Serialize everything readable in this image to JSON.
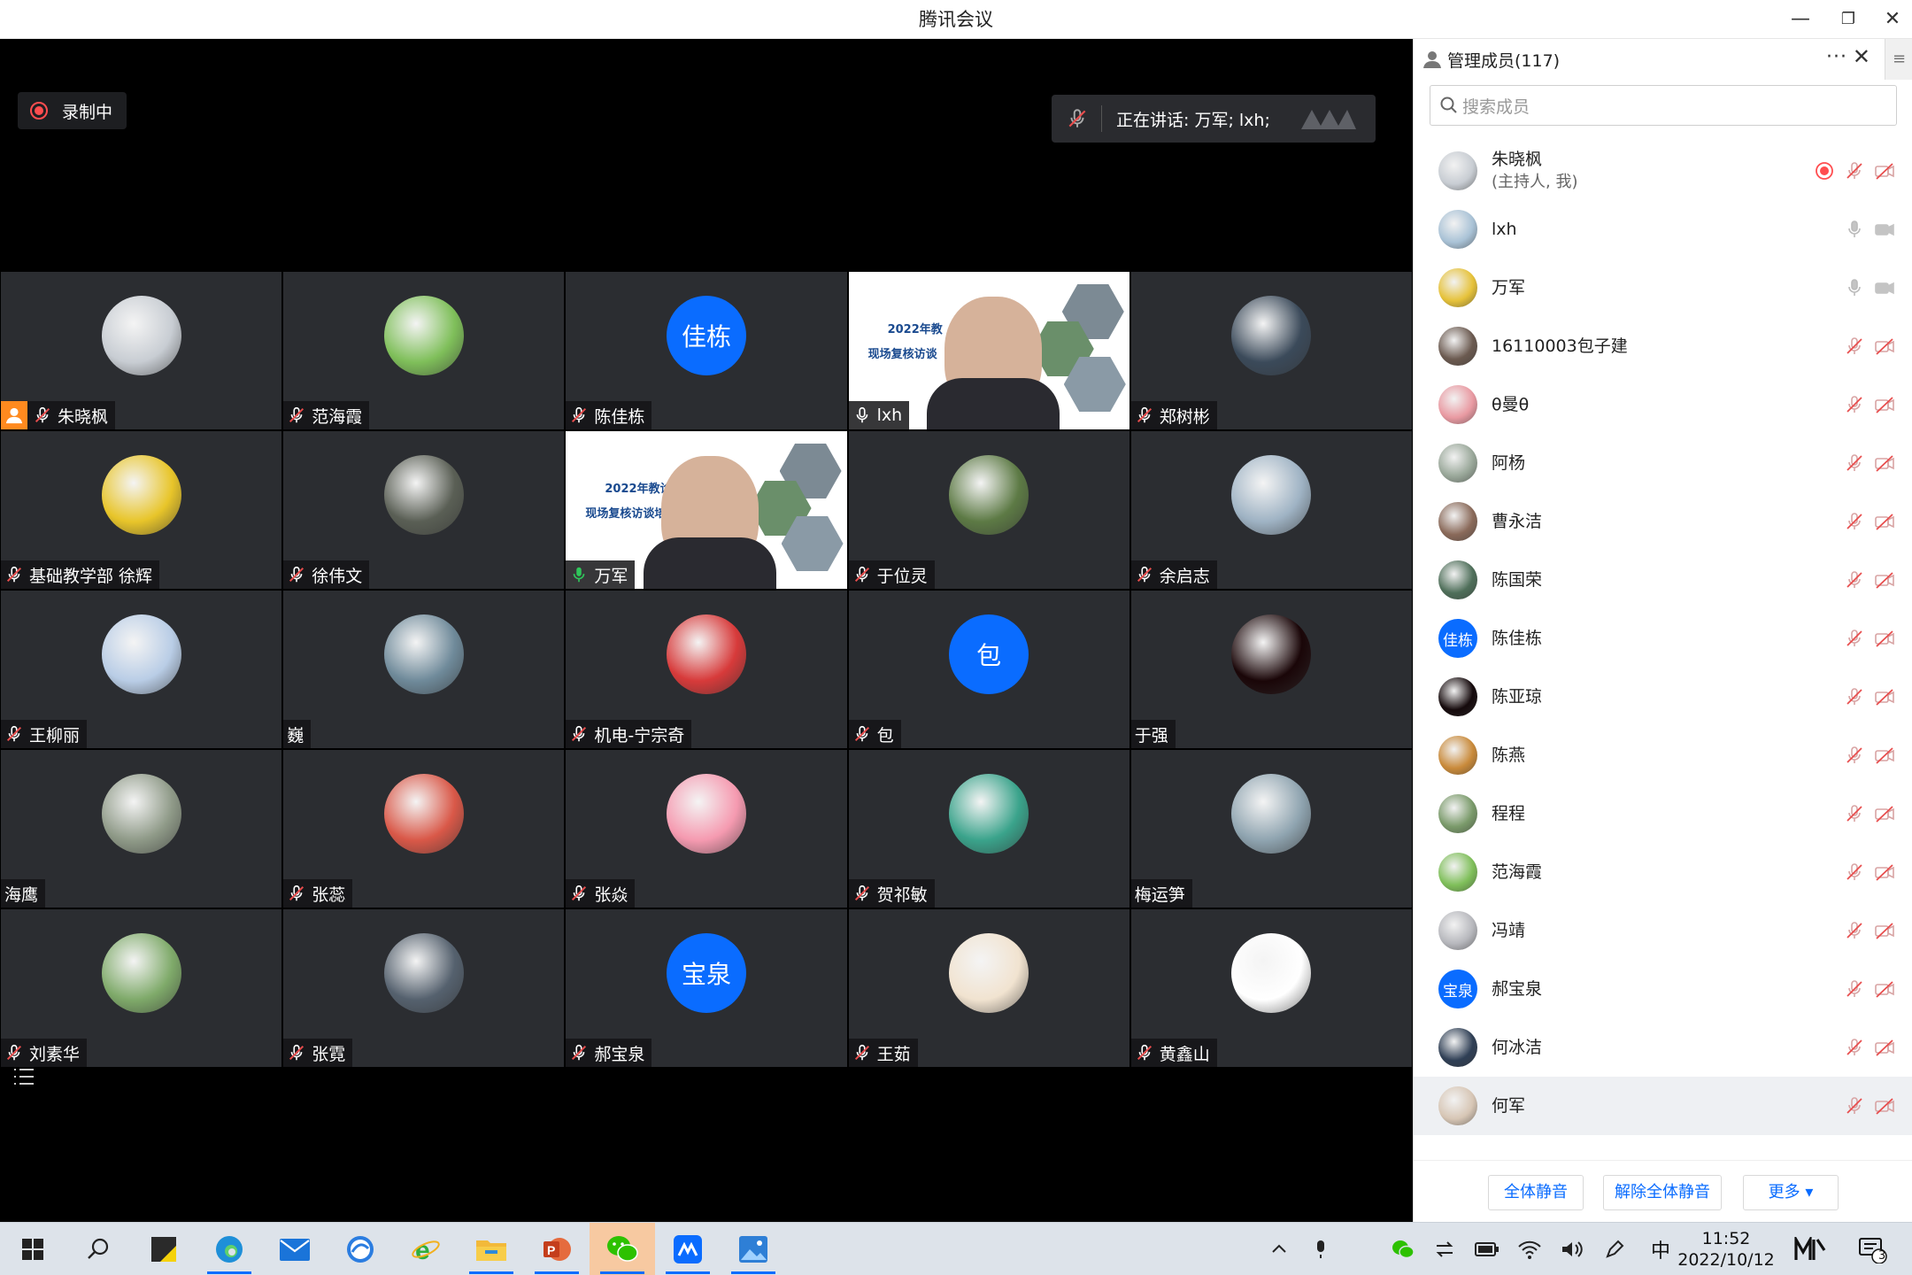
{
  "window": {
    "title": "腾讯会议"
  },
  "stage": {
    "recording_label": "录制中",
    "speaking_label": "正在讲话: 万军; lxh;"
  },
  "tiles": [
    {
      "name": "朱晓枫",
      "mic": "muted",
      "host": true,
      "avatar": "img",
      "color": "#c8cdd3"
    },
    {
      "name": "范海霞",
      "mic": "muted",
      "avatar": "img",
      "color": "#7fbf5a"
    },
    {
      "name": "陈佳栋",
      "mic": "muted",
      "avatar": "text",
      "avatar_text": "佳栋"
    },
    {
      "name": "lxh",
      "mic": "on",
      "avatar": "video",
      "video_text": "2022年教",
      "video_text2": "现场复核访谈"
    },
    {
      "name": "郑树彬",
      "mic": "muted",
      "avatar": "img",
      "color": "#3b4a5a"
    },
    {
      "name": "基础教学部 徐辉",
      "mic": "muted",
      "avatar": "img",
      "color": "#e8c52a"
    },
    {
      "name": "徐伟文",
      "mic": "muted",
      "avatar": "img",
      "color": "#5a5f55"
    },
    {
      "name": "万军",
      "mic": "speaking",
      "avatar": "video",
      "active": true,
      "video_text": "2022年教诊改工",
      "video_text2": "现场复核访谈培训会"
    },
    {
      "name": "于位灵",
      "mic": "muted",
      "avatar": "img",
      "color": "#5d7a45"
    },
    {
      "name": "余启志",
      "mic": "muted",
      "avatar": "img",
      "color": "#9fb3c4"
    },
    {
      "name": "王柳丽",
      "mic": "muted",
      "avatar": "img",
      "color": "#b9cde6"
    },
    {
      "name": "巍",
      "mic": "none",
      "avatar": "img",
      "color": "#6f8a9a"
    },
    {
      "name": "机电-宁宗奇",
      "mic": "muted",
      "avatar": "img",
      "color": "#d73a3a"
    },
    {
      "name": "包",
      "mic": "muted",
      "avatar": "text",
      "avatar_text": "包"
    },
    {
      "name": "于强",
      "mic": "none",
      "avatar": "img",
      "color": "#1a0608"
    },
    {
      "name": "海鹰",
      "mic": "none",
      "avatar": "img",
      "color": "#8f9a88"
    },
    {
      "name": "张蕊",
      "mic": "muted",
      "avatar": "img",
      "color": "#d95848"
    },
    {
      "name": "张焱",
      "mic": "muted",
      "avatar": "img",
      "color": "#f59ab0"
    },
    {
      "name": "贺祁敏",
      "mic": "muted",
      "avatar": "img",
      "color": "#3aa38b"
    },
    {
      "name": "梅运笋",
      "mic": "none",
      "avatar": "img",
      "color": "#8fa4b0"
    },
    {
      "name": "刘素华",
      "mic": "muted",
      "avatar": "img",
      "color": "#7faa6a"
    },
    {
      "name": "张霓",
      "mic": "muted",
      "avatar": "img",
      "color": "#55616e"
    },
    {
      "name": "郝宝泉",
      "mic": "muted",
      "avatar": "text",
      "avatar_text": "宝泉"
    },
    {
      "name": "王茹",
      "mic": "muted",
      "avatar": "img",
      "color": "#f1e3d0"
    },
    {
      "name": "黄鑫山",
      "mic": "muted",
      "avatar": "img",
      "color": "#ffffff"
    }
  ],
  "panel": {
    "title": "管理成员(117)",
    "search_placeholder": "搜索成员",
    "buttons": {
      "mute_all": "全体静音",
      "unmute_all": "解除全体静音",
      "more": "更多 ▾"
    },
    "members": [
      {
        "name": "朱晓枫",
        "sub": "(主持人, 我)",
        "avatar": "img",
        "color": "#c8cdd3",
        "rec": true,
        "mic": "muted",
        "cam": "off"
      },
      {
        "name": "lxh",
        "avatar": "img",
        "color": "#a9c2d6",
        "mic": "on",
        "cam": "on"
      },
      {
        "name": "万军",
        "avatar": "img",
        "color": "#e6c23a",
        "mic": "on",
        "cam": "on"
      },
      {
        "name": "16110003包子建",
        "avatar": "img",
        "color": "#6b5a50",
        "mic": "muted",
        "cam": "off"
      },
      {
        "name": "θ曼θ",
        "avatar": "img",
        "color": "#e99aa2",
        "mic": "muted",
        "cam": "off"
      },
      {
        "name": "阿杨",
        "avatar": "img",
        "color": "#9aa89a",
        "mic": "muted",
        "cam": "off"
      },
      {
        "name": "曹永洁",
        "avatar": "img",
        "color": "#8a6a5a",
        "mic": "muted",
        "cam": "off"
      },
      {
        "name": "陈国荣",
        "avatar": "img",
        "color": "#4f6f5a",
        "mic": "muted",
        "cam": "off"
      },
      {
        "name": "陈佳栋",
        "avatar": "text",
        "avatar_text": "佳栋",
        "mic": "muted",
        "cam": "off"
      },
      {
        "name": "陈亚琼",
        "avatar": "img",
        "color": "#150a0c",
        "mic": "muted",
        "cam": "off"
      },
      {
        "name": "陈燕",
        "avatar": "img",
        "color": "#c98a3a",
        "mic": "muted",
        "cam": "off"
      },
      {
        "name": "程程",
        "avatar": "img",
        "color": "#7a9a6a",
        "mic": "muted",
        "cam": "off"
      },
      {
        "name": "范海霞",
        "avatar": "img",
        "color": "#7fbf5a",
        "mic": "muted",
        "cam": "off"
      },
      {
        "name": "冯靖",
        "avatar": "img",
        "color": "#b7b8bd",
        "mic": "muted",
        "cam": "off"
      },
      {
        "name": "郝宝泉",
        "avatar": "text",
        "avatar_text": "宝泉",
        "mic": "muted",
        "cam": "off"
      },
      {
        "name": "何冰洁",
        "avatar": "img",
        "color": "#2f3f55",
        "mic": "muted",
        "cam": "off"
      },
      {
        "name": "何军",
        "avatar": "img",
        "color": "#d7c6b5",
        "mic": "muted",
        "cam": "off",
        "highlight": true
      }
    ]
  },
  "taskbar": {
    "apps": [
      "start-icon",
      "search-icon",
      "sticky-notes-icon",
      "edge-icon",
      "mail-icon",
      "browser-icon",
      "ie-icon",
      "file-explorer-icon",
      "powerpoint-icon",
      "wechat-icon",
      "tencent-meeting-icon",
      "photos-icon"
    ],
    "ime": "中",
    "time": "11:52",
    "date": "2022/10/12",
    "notification_count": "3"
  },
  "colors": {
    "accent": "#0a6cff",
    "record": "#ff4d4f",
    "speaking": "#2fc65a",
    "muted": "#e84d4d",
    "tile_bg": "#2b2d31"
  }
}
